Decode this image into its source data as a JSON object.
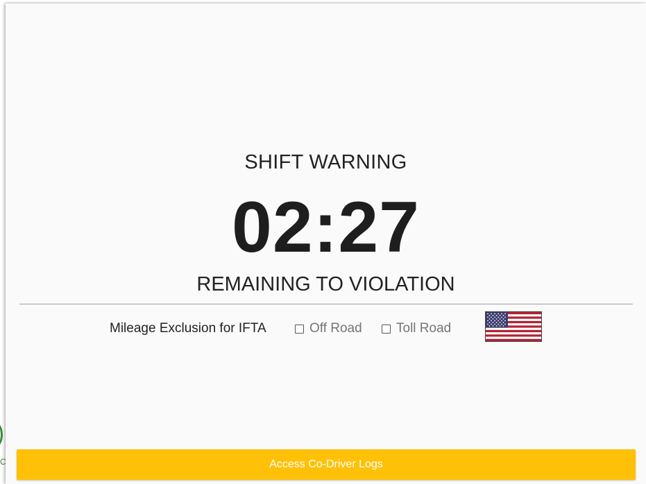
{
  "dialog": {
    "title": "SHIFT WARNING",
    "countdown": "02:27",
    "subtitle": "REMAINING TO VIOLATION"
  },
  "mileage": {
    "label": "Mileage Exclusion for IFTA",
    "options": [
      {
        "label": "Off Road",
        "checked": false
      },
      {
        "label": "Toll Road",
        "checked": false
      }
    ],
    "flag_icon": "us-flag-icon"
  },
  "footer": {
    "button_label": "Access Co-Driver Logs",
    "button_color": "#ffc107"
  },
  "background": {
    "peek_letter": "C"
  },
  "colors": {
    "accent": "#ffc107",
    "text_primary": "#222222",
    "text_muted": "#757575",
    "peek_green": "#3a8c3a"
  }
}
